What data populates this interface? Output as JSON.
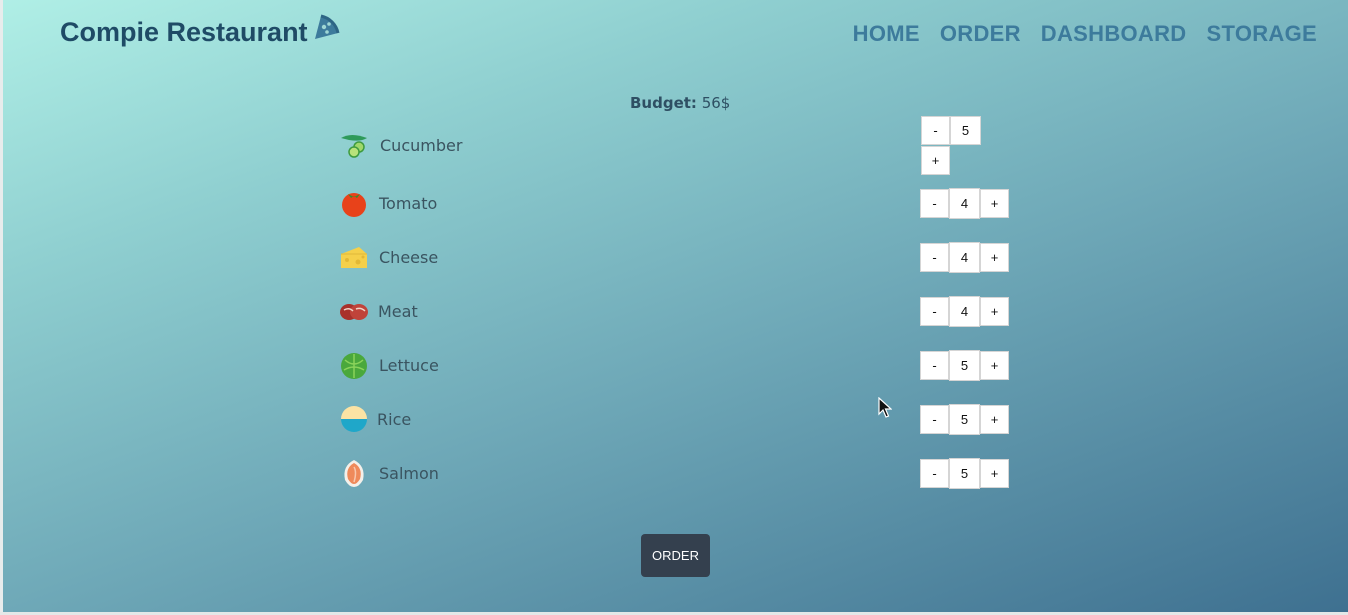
{
  "brand": {
    "title": "Compie Restaurant",
    "icon": "pizza-slice-icon"
  },
  "nav": {
    "home": "HOME",
    "order": "ORDER",
    "dashboard": "DASHBOARD",
    "storage": "STORAGE"
  },
  "budget": {
    "label": "Budget:",
    "value": "56$"
  },
  "ingredients": [
    {
      "name": "Cucumber",
      "qty": "5",
      "icon": "cucumber-icon"
    },
    {
      "name": "Tomato",
      "qty": "4",
      "icon": "tomato-icon"
    },
    {
      "name": "Cheese",
      "qty": "4",
      "icon": "cheese-icon"
    },
    {
      "name": "Meat",
      "qty": "4",
      "icon": "meat-icon"
    },
    {
      "name": "Lettuce",
      "qty": "5",
      "icon": "lettuce-icon"
    },
    {
      "name": "Rice",
      "qty": "5",
      "icon": "rice-icon"
    },
    {
      "name": "Salmon",
      "qty": "5",
      "icon": "salmon-icon"
    }
  ],
  "controls": {
    "minus": "-",
    "plus": "+"
  },
  "order_button": "ORDER",
  "colors": {
    "brand": "#1f4b66",
    "nav": "#3d7b9c",
    "order_button": "#34404e"
  }
}
